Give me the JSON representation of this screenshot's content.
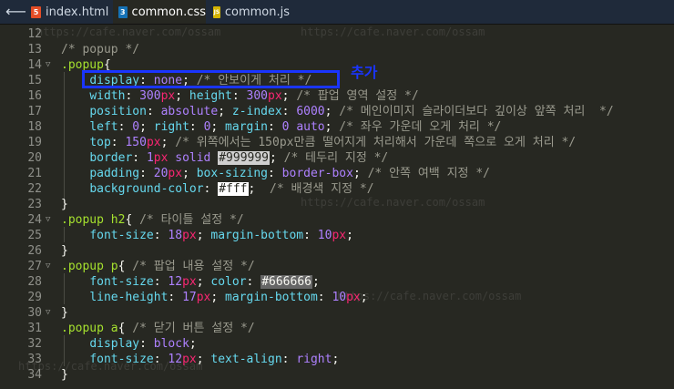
{
  "tabs": [
    {
      "label": "index.html",
      "icon": "html-file-icon",
      "icon_glyph": "5",
      "icon_color": "#e44d26"
    },
    {
      "label": "common.css",
      "icon": "css-file-icon",
      "icon_glyph": "3",
      "icon_color": "#1572b6"
    },
    {
      "label": "common.js",
      "icon": "js-file-icon",
      "icon_glyph": "JS",
      "icon_color": "#d4b300"
    }
  ],
  "line_numbers": [
    "12",
    "13",
    "14",
    "15",
    "16",
    "17",
    "18",
    "19",
    "20",
    "21",
    "22",
    "23",
    "24",
    "25",
    "26",
    "27",
    "28",
    "29",
    "30",
    "31",
    "32",
    "33",
    "34"
  ],
  "annotation": "추가",
  "watermark": "https://cafe.naver.com/ossam",
  "code": {
    "l13_comment": "/* popup */",
    "l14_selector": ".popup",
    "l15_prop": "display",
    "l15_val": "none",
    "l15_comment": "/* 안보이게 처리 */",
    "l16_p1": "width",
    "l16_v1n": "300",
    "l16_v1u": "px",
    "l16_p2": "height",
    "l16_v2n": "300",
    "l16_v2u": "px",
    "l16_comment": "/* 팝업 영역 설정 */",
    "l17_p1": "position",
    "l17_v1": "absolute",
    "l17_p2": "z-index",
    "l17_v2": "6000",
    "l17_comment": "/* 메인이미지 슬라이더보다 깊이상 앞쪽 처리  */",
    "l18_p1": "left",
    "l18_v1": "0",
    "l18_p2": "right",
    "l18_v2": "0",
    "l18_p3": "margin",
    "l18_v3a": "0",
    "l18_v3b": "auto",
    "l18_comment": "/* 좌우 가운데 오게 처리 */",
    "l19_p1": "top",
    "l19_v1n": "150",
    "l19_v1u": "px",
    "l19_comment": "/* 위쪽에서는 150px만큼 떨어지게 처리해서 가운데 쪽으로 오게 처리 */",
    "l20_p1": "border",
    "l20_v1n": "1",
    "l20_v1u": "px",
    "l20_v1s": "solid",
    "l20_v1c": "#999999",
    "l20_comment": "/* 테두리 지정 */",
    "l21_p1": "padding",
    "l21_v1n": "20",
    "l21_v1u": "px",
    "l21_p2": "box-sizing",
    "l21_v2": "border-box",
    "l21_comment": "/* 안쪽 여백 지정 */",
    "l22_p1": "background-color",
    "l22_v1": "#fff",
    "l22_comment": "/* 배경색 지정 */",
    "l24_sel": ".popup h2",
    "l24_comment": "/* 타이틀 설정 */",
    "l25_p1": "font-size",
    "l25_v1n": "18",
    "l25_v1u": "px",
    "l25_p2": "margin-bottom",
    "l25_v2n": "10",
    "l25_v2u": "px",
    "l27_sel": ".popup p",
    "l27_comment": "/* 팝업 내용 설정 */",
    "l28_p1": "font-size",
    "l28_v1n": "12",
    "l28_v1u": "px",
    "l28_p2": "color",
    "l28_v2": "#666666",
    "l29_p1": "line-height",
    "l29_v1n": "17",
    "l29_v1u": "px",
    "l29_p2": "margin-bottom",
    "l29_v2n": "10",
    "l29_v2u": "px",
    "l31_sel": ".popup a",
    "l31_comment": "/* 닫기 버튼 설정 */",
    "l32_p1": "display",
    "l32_v1": "block",
    "l33_p1": "font-size",
    "l33_v1n": "12",
    "l33_v1u": "px",
    "l33_p2": "text-align",
    "l33_v2": "right"
  }
}
